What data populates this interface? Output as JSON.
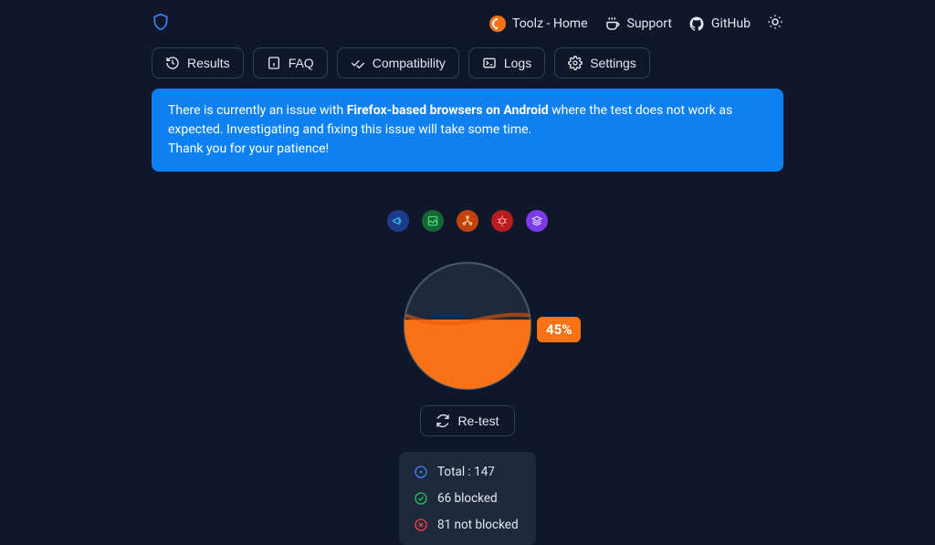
{
  "header": {
    "home_label": "Toolz - Home",
    "support_label": "Support",
    "github_label": "GitHub"
  },
  "tabs": {
    "results": "Results",
    "faq": "FAQ",
    "compatibility": "Compatibility",
    "logs": "Logs",
    "settings": "Settings"
  },
  "alert": {
    "pre": "There is currently an issue with ",
    "bold": "Firefox-based browsers on Android",
    "post": " where the test does not work as expected. Investigating and fixing this issue will take some time.",
    "line2": "Thank you for your patience!"
  },
  "retest_label": "Re-test",
  "stats": {
    "total_label": "Total : 147",
    "blocked_label": "66 blocked",
    "notblocked_label": "81 not blocked"
  },
  "chart_data": {
    "type": "pie",
    "title": "",
    "values": [
      55,
      45
    ],
    "categories": [
      "not blocked (fill)",
      "blocked (empty)"
    ],
    "colors": [
      "#f97316",
      "#1e293b"
    ],
    "percent_label": "45%",
    "percent_value": 45
  }
}
